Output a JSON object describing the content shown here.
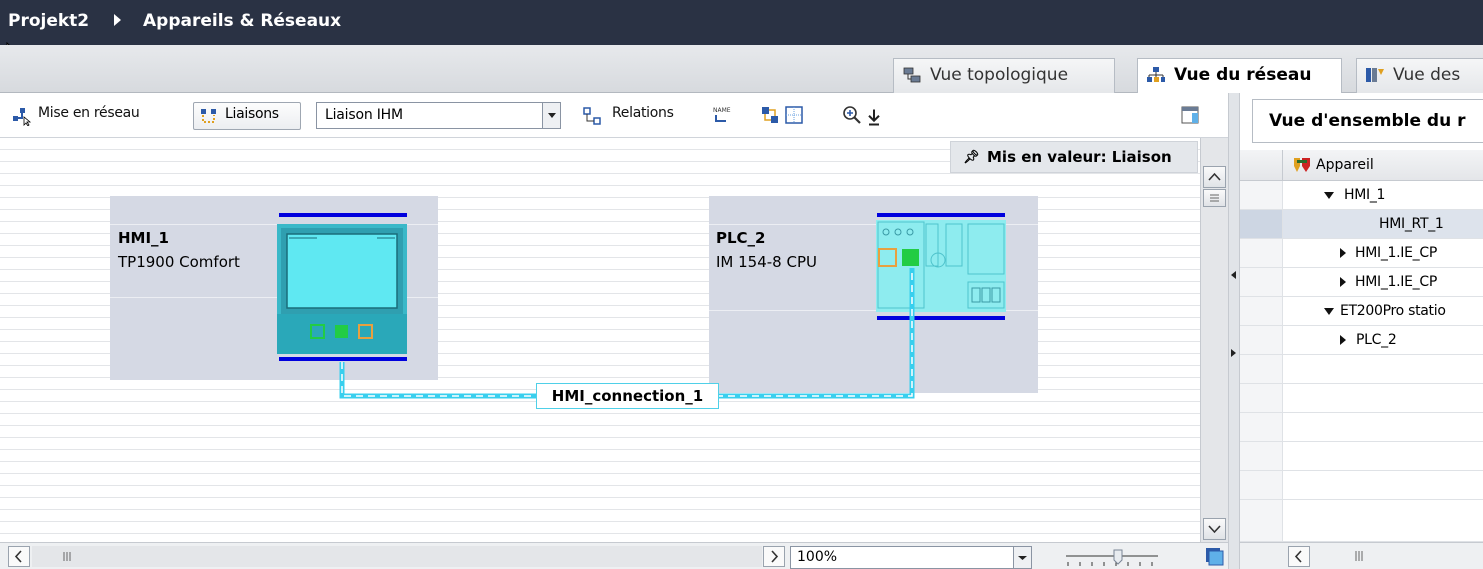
{
  "breadcrumb": {
    "project": "Projekt2",
    "section": "Appareils & Réseaux"
  },
  "view_tabs": [
    {
      "label": "Vue topologique",
      "active": false
    },
    {
      "label": "Vue du réseau",
      "active": true
    },
    {
      "label": "Vue des",
      "active": false
    }
  ],
  "toolbar": {
    "network_label": "Mise en réseau",
    "connections_label": "Liaisons",
    "connection_type": "Liaison IHM",
    "relations_label": "Relations"
  },
  "canvas": {
    "highlight_label": "Mis en valeur: Liaison",
    "devices": [
      {
        "name": "HMI_1",
        "type": "TP1900 Comfort"
      },
      {
        "name": "PLC_2",
        "type": "IM 154-8 CPU"
      }
    ],
    "connection_label": "HMI_connection_1",
    "zoom": "100%"
  },
  "overview": {
    "tab_label": "Vue d'ensemble du r",
    "column_header": "Appareil",
    "rows": [
      {
        "label": "HMI_1",
        "expander": "expanded",
        "level": 0
      },
      {
        "label": "HMI_RT_1",
        "expander": "none",
        "level": 2,
        "selected": true
      },
      {
        "label": "HMI_1.IE_CP",
        "expander": "collapsed",
        "level": 1
      },
      {
        "label": "HMI_1.IE_CP",
        "expander": "collapsed",
        "level": 1
      },
      {
        "label": "ET200Pro statio",
        "expander": "expanded",
        "level": 0
      },
      {
        "label": "PLC_2",
        "expander": "collapsed",
        "level": 1
      }
    ]
  },
  "colors": {
    "titlebar": "#2a3244",
    "device_bg": "#d5d9e4",
    "bus_blue": "#0000dd",
    "connection_cyan": "#38cfee",
    "screen_cyan": "#5fe8f2"
  }
}
